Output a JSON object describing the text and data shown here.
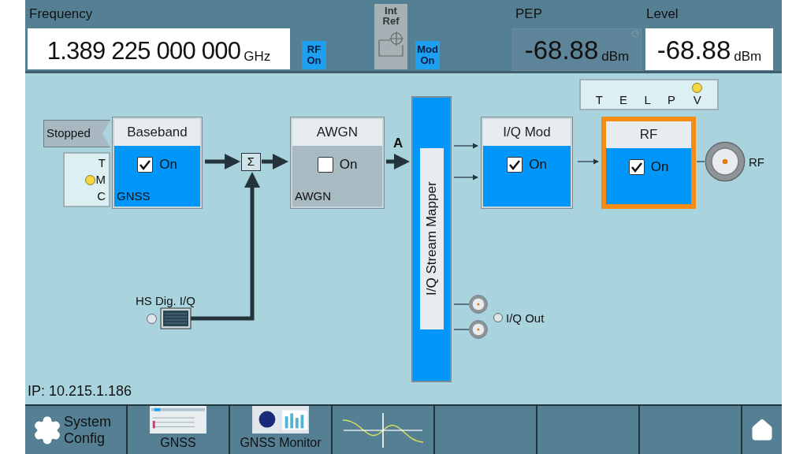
{
  "header": {
    "frequency": {
      "label": "Frequency",
      "value": "1.389 225 000 000",
      "unit": "GHz"
    },
    "rf_button": {
      "lines": [
        "RF",
        "On"
      ],
      "on": true
    },
    "reference": {
      "lines": [
        "Int",
        "Ref"
      ]
    },
    "mod_button": {
      "lines": [
        "Mod",
        "On"
      ],
      "on": true
    },
    "pep": {
      "label": "PEP",
      "value": "-68.88",
      "unit": "dBm"
    },
    "level": {
      "label": "Level",
      "value": "-68.88",
      "unit": "dBm"
    }
  },
  "diagram": {
    "status_tag": "Stopped",
    "trigger_indicators": [
      {
        "label": "T",
        "lit": false
      },
      {
        "label": "M",
        "lit": true
      },
      {
        "label": "C",
        "lit": false
      }
    ],
    "sum_symbol": "Σ",
    "path_label": "A",
    "stream_mapper": "I/Q Stream Mapper",
    "blocks": [
      {
        "title": "Baseband",
        "checked": true,
        "check_label": "On",
        "sub_label": "GNSS",
        "selected": false
      },
      {
        "title": "AWGN",
        "checked": false,
        "check_label": "On",
        "sub_label": "AWGN",
        "selected": false
      },
      {
        "title": "I/Q Mod",
        "checked": true,
        "check_label": "On",
        "selected": false
      },
      {
        "title": "RF",
        "checked": true,
        "check_label": "On",
        "selected": true
      }
    ],
    "rf_indicators": [
      {
        "label": "T",
        "lit": false
      },
      {
        "label": "E",
        "lit": false
      },
      {
        "label": "L",
        "lit": false
      },
      {
        "label": "P",
        "lit": false
      },
      {
        "label": "V",
        "lit": true
      }
    ],
    "rf_output": "RF",
    "hs_input": "HS Dig. I/Q",
    "iq_out": "I/Q Out",
    "ip": "IP: 10.215.1.186"
  },
  "taskbar": [
    {
      "kind": "settings",
      "label": "System Config"
    },
    {
      "kind": "thumb",
      "label": "GNSS"
    },
    {
      "kind": "monitor",
      "label": "GNSS Monitor"
    },
    {
      "kind": "wave"
    },
    {
      "kind": "empty"
    },
    {
      "kind": "empty"
    },
    {
      "kind": "empty"
    },
    {
      "kind": "home"
    }
  ]
}
